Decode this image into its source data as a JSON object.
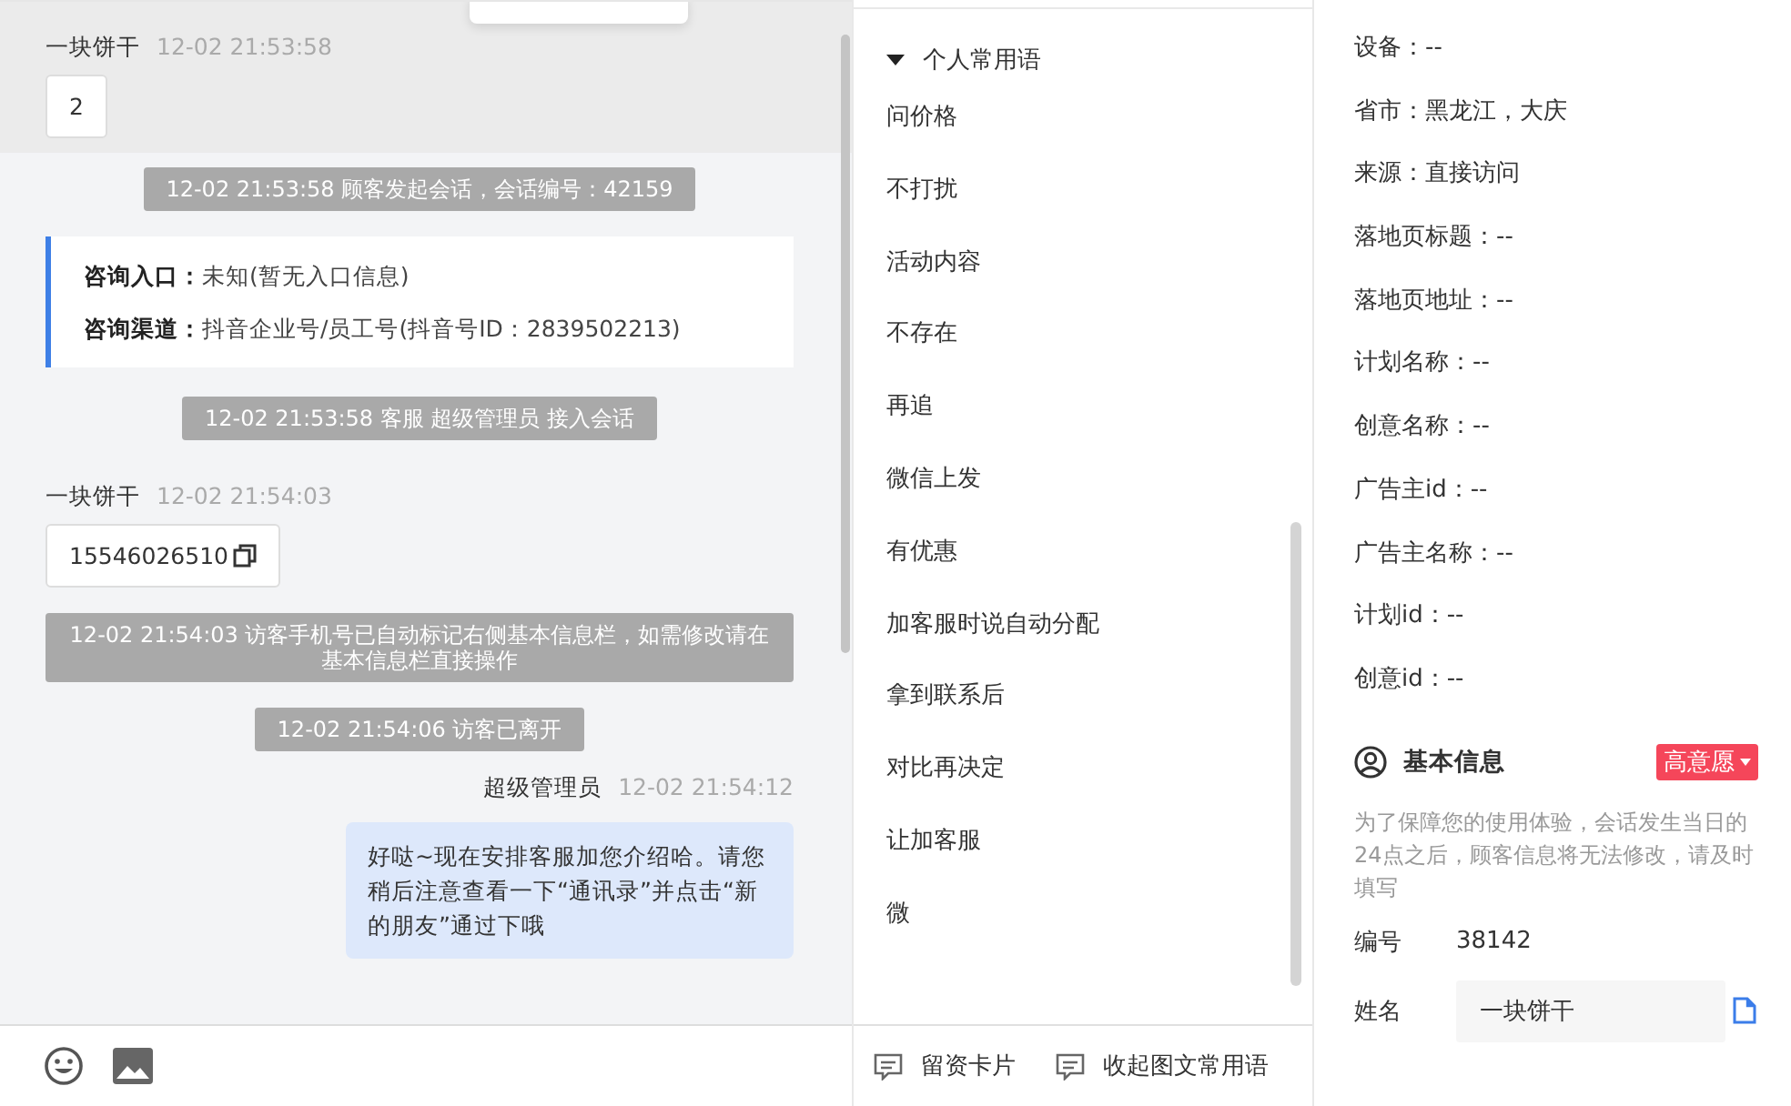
{
  "chat": {
    "messages": [
      {
        "kind": "visitor",
        "name": "一块饼干",
        "time": "12-02 21:53:58",
        "text": "2",
        "highlighted": true,
        "copyable": false
      },
      {
        "kind": "system",
        "text": "12-02 21:53:58 顾客发起会话，会话编号：42159"
      },
      {
        "kind": "entry",
        "rows": [
          {
            "label": "咨询入口：",
            "value": "未知(暂无入口信息)"
          },
          {
            "label": "咨询渠道：",
            "value": "抖音企业号/员工号(抖音号ID：2839502213)"
          }
        ]
      },
      {
        "kind": "system",
        "text": "12-02 21:53:58 客服 超级管理员 接入会话"
      },
      {
        "kind": "visitor",
        "name": "一块饼干",
        "time": "12-02 21:54:03",
        "text": "15546026510",
        "highlighted": false,
        "copyable": true
      },
      {
        "kind": "system",
        "text": "12-02 21:54:03 访客手机号已自动标记右侧基本信息栏，如需修改请在基本信息栏直接操作"
      },
      {
        "kind": "system",
        "text": "12-02 21:54:06 访客已离开"
      },
      {
        "kind": "agent",
        "name": "超级管理员",
        "time": "12-02 21:54:12",
        "text": "好哒~现在安排客服加您介绍哈。请您稍后注意查看一下“通讯录”并点击“新的朋友”通过下哦"
      }
    ]
  },
  "phrases": {
    "group": "个人常用语",
    "expanded": true,
    "items": [
      "问价格",
      "不打扰",
      "活动内容",
      "不存在",
      "再追",
      "微信上发",
      "有优惠",
      "加客服时说自动分配",
      "拿到联系后",
      "对比再决定",
      "让加客服",
      "微"
    ],
    "actions": [
      "留资卡片",
      "收起图文常用语"
    ]
  },
  "visitor_info": {
    "fields": [
      "设备：--",
      "省市：黑龙江，大庆",
      "来源：直接访问",
      "落地页标题：--",
      "落地页地址：--",
      "计划名称：--",
      "创意名称：--",
      "广告主id：--",
      "广告主名称：--",
      "计划id：--",
      "创意id：--"
    ]
  },
  "basic_info": {
    "title": "基本信息",
    "intent": "高意愿",
    "notice": "为了保障您的使用体验，会话发生当日的24点之后，顾客信息将无法修改，请及时填写",
    "id_label": "编号",
    "id_value": "38142",
    "name_label": "姓名",
    "name_value": "一块饼干"
  }
}
